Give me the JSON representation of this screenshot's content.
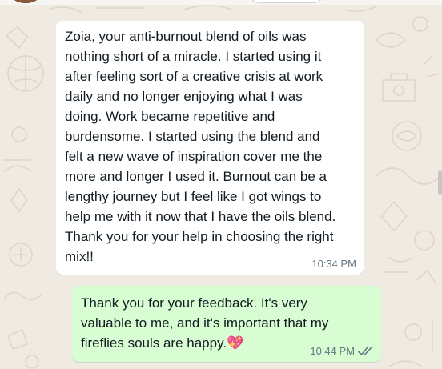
{
  "chat": {
    "messages": [
      {
        "direction": "incoming",
        "text": "Zoia, your anti-burnout blend of oils was\nnothing short of a miracle. I started using it\nafter feeling sort of a creative crisis at work\ndaily and no longer enjoying what I was\ndoing. Work became repetitive and\nburdensome. I started using the blend and\nfelt a new wave of inspiration cover me the\nmore and longer I used it. Burnout can be a\nlengthy journey but I feel like I got wings to\nhelp me with it now that I have the oils blend.\nThank you for your help in choosing the right\nmix!!",
        "time": "10:34 PM"
      },
      {
        "direction": "outgoing",
        "text": "Thank you for your feedback. It's very\nvaluable to me, and it's important that my\nfireflies souls are happy.",
        "emoji": "💖",
        "emoji_icon": "sparkling-heart-icon",
        "time": "10:44 PM",
        "status_icon": "double-check-icon"
      }
    ]
  },
  "colors": {
    "chat_background": "#efeae2",
    "incoming_bubble": "#ffffff",
    "outgoing_bubble": "#d9fdd3",
    "text": "#111b21",
    "meta_text": "#667781"
  }
}
